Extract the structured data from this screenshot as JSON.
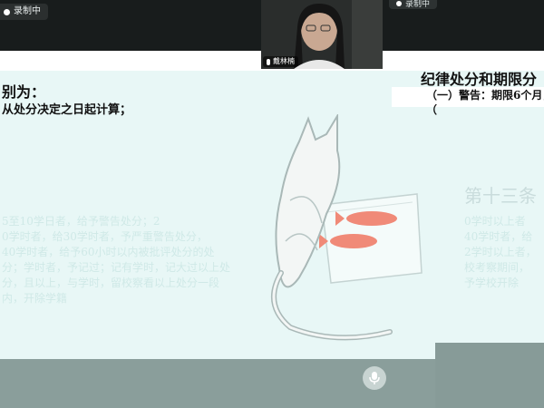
{
  "recording": {
    "label": "录制中"
  },
  "recording_right": {
    "label": "录制中"
  },
  "webcam": {
    "participant_name": "戴林楠"
  },
  "slide": {
    "left_heading": "别为：",
    "left_line": "从处分决定之日起计算；",
    "right_heading": "纪律处分和期限分",
    "right_line_1": "（一）警告：期限6个月，",
    "right_line_2": "（",
    "right_article": "第十三条"
  },
  "faint_left_lines": [
    "5至10学日者，给予警告处分；2",
    "0学时者，给30学时者，予严重警告处分，",
    "40学时者，给予60小时以内被批评处分的处",
    "分；学时者，予记过；记有学时，记大过以上处",
    "分，且以上，与学时，留校察看以上处分一段",
    "内，开除学籍"
  ],
  "faint_right_lines": [
    "0学时以上者",
    "40学时者，给",
    "2学时以上者，",
    "校考察期间，",
    "予学校开除"
  ],
  "colors": {
    "topbar": "#181c1c",
    "slide_bg": "#e8f7f6",
    "bottombar": "#8a9e9b",
    "fish": "#f08a78"
  }
}
